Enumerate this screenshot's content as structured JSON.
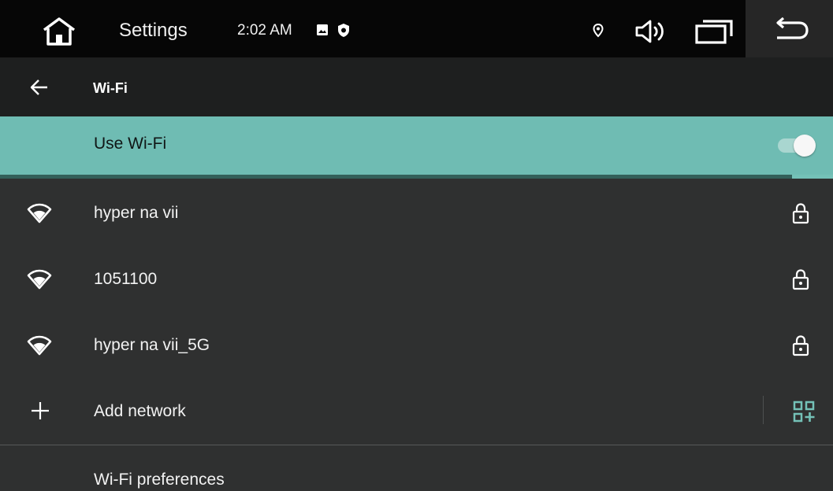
{
  "status_bar": {
    "app_name": "Settings",
    "time": "2:02 AM",
    "icons": [
      "home-icon",
      "image-icon",
      "shield-icon",
      "location-icon",
      "volume-icon",
      "recents-icon",
      "back-icon"
    ]
  },
  "app_bar": {
    "title": "Wi-Fi",
    "back_icon": "arrow-left-icon"
  },
  "use_wifi": {
    "label": "Use Wi-Fi",
    "enabled": true,
    "accent": "#6fbcb3"
  },
  "networks": [
    {
      "ssid": "hyper na vii",
      "secured": true
    },
    {
      "ssid": "1051100",
      "secured": true
    },
    {
      "ssid": "hyper na vii_5G",
      "secured": true
    }
  ],
  "add_network": {
    "label": "Add network",
    "qr_icon": "qr-scan-icon"
  },
  "preferences": {
    "label": "Wi-Fi preferences"
  }
}
